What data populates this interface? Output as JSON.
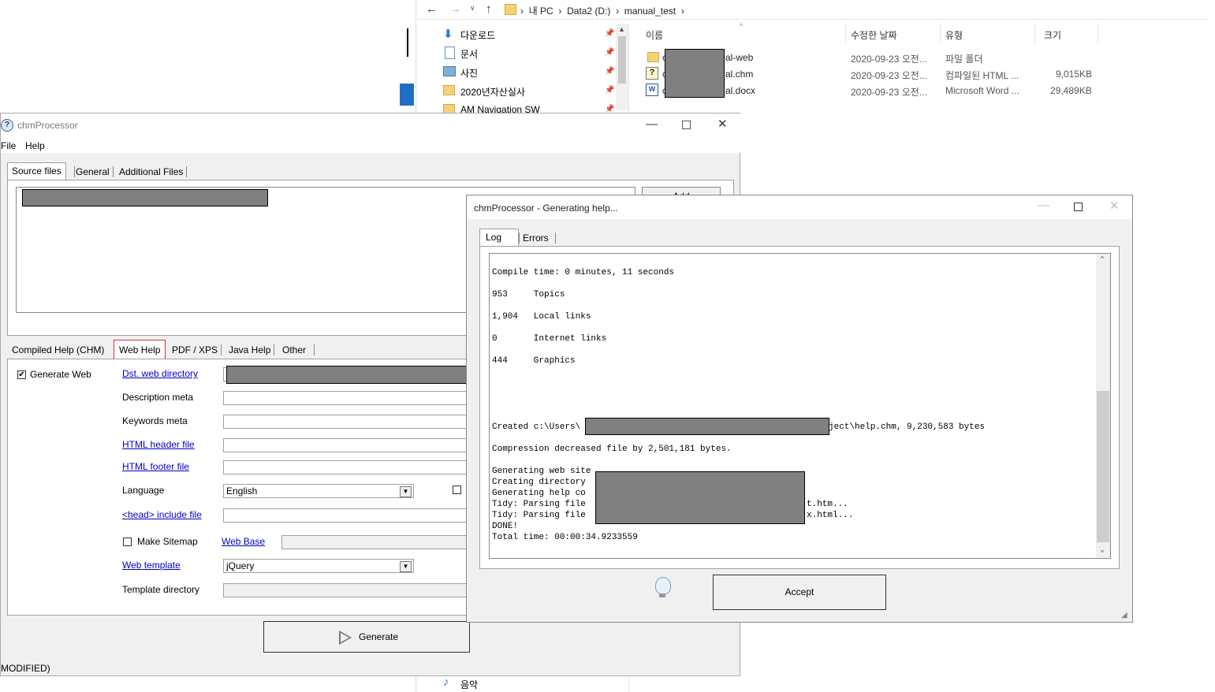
{
  "explorer": {
    "breadcrumb": [
      "내 PC",
      "Data2 (D:)",
      "manual_test"
    ],
    "nav_items": [
      {
        "label": "다운로드",
        "icon": "download-arrow-icon"
      },
      {
        "label": "문서",
        "icon": "document-icon"
      },
      {
        "label": "사진",
        "icon": "picture-icon"
      },
      {
        "label": "2020년자산실사",
        "icon": "folder-icon"
      },
      {
        "label": "AM Navigation SW",
        "icon": "folder-icon"
      }
    ],
    "bottom_nav": {
      "label": "음악",
      "icon": "music-note-icon"
    },
    "columns": {
      "name": "이름",
      "modified": "수정한 날짜",
      "type": "유형",
      "size": "크기"
    },
    "files": [
      {
        "name_prefix": "c",
        "name_suffix": "al-web",
        "modified": "2020-09-23 오전...",
        "type": "파일 폴더",
        "size": "",
        "icon": "folder-icon"
      },
      {
        "name_prefix": "c",
        "name_suffix": "al.chm",
        "modified": "2020-09-23 오전...",
        "type": "컴파일된 HTML ...",
        "size": "9,015KB",
        "icon": "chm-help-icon"
      },
      {
        "name_prefix": "c",
        "name_suffix": "al.docx",
        "modified": "2020-09-23 오전...",
        "type": "Microsoft Word ...",
        "size": "29,489KB",
        "icon": "word-document-icon"
      }
    ]
  },
  "main": {
    "title": "chmProcessor",
    "menu": [
      "File",
      "Help"
    ],
    "top_tabs": [
      "Source files",
      "General",
      "Additional Files"
    ],
    "add_button": "Add",
    "bottom_tabs": [
      "Compiled Help (CHM)",
      "Web Help",
      "PDF / XPS",
      "Java Help",
      "Other"
    ],
    "generate_web_label": "Generate Web",
    "generate_web_checked": true,
    "labels": {
      "dst_dir": "Dst. web directory",
      "description": "Description meta",
      "keywords": "Keywords meta",
      "header_file": "HTML header file",
      "footer_file": "HTML footer file",
      "language": "Language",
      "head_include": "<head> include file",
      "make_sitemap": "Make Sitemap",
      "web_base": "Web Base",
      "web_template": "Web template",
      "template_dir": "Template directory"
    },
    "language_value": "English",
    "template_value": "jQuery",
    "make_sitemap_checked": false,
    "generate_button": "Generate",
    "status": "MODIFIED)"
  },
  "dialog": {
    "title": "chmProcessor  - Generating help...",
    "tabs": [
      "Log",
      "Errors"
    ],
    "log_lines": [
      "Compile time: 0 minutes, 11 seconds",
      "953     Topics",
      "1,904   Local links",
      "0       Internet links",
      "444     Graphics",
      "Created c:\\Users\\",
      "ject\\help.chm, 9,230,583 bytes",
      "Compression decreased file by 2,501,181 bytes.",
      "Generating web site",
      "Creating directory",
      "Generating help co",
      "Tidy: Parsing file",
      "t.htm...",
      "Tidy: Parsing file",
      "x.html...",
      "DONE!",
      "Total time: 00:00:34.9233559"
    ],
    "accept_button": "Accept"
  }
}
